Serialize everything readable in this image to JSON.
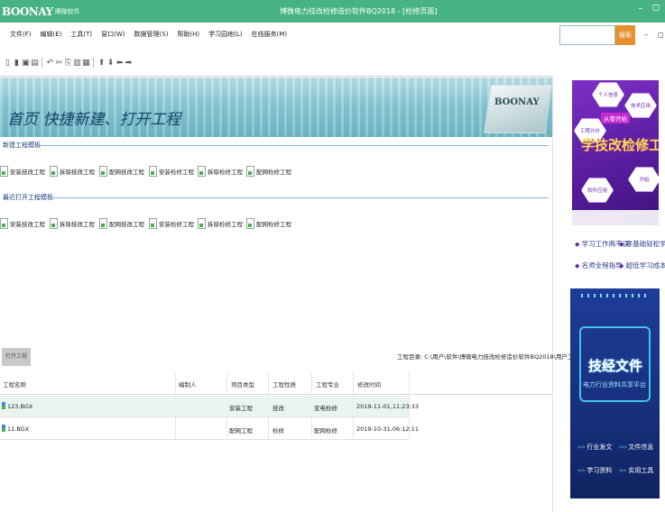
{
  "titlebar": {
    "logo_brand": "BOONAY",
    "logo_sub": "博微软件",
    "title": "博微电力技改检修造价软件BQ2018 - [检修页面]",
    "min_glyph": "–",
    "close_glyph": "◻"
  },
  "menu": [
    "文件(F)",
    "编辑(E)",
    "工具(T)",
    "窗口(W)",
    "数据管理(S)",
    "帮助(H)",
    "学习园地(L)",
    "在线服务(M)"
  ],
  "search": {
    "placeholder": "",
    "button": "搜索"
  },
  "top_controls": {
    "min": "–",
    "close": "◻"
  },
  "toolbar": {
    "icons": [
      "new-file-icon",
      "open-folder-icon",
      "save-icon",
      "save-all-icon",
      "undo-icon",
      "cut-icon",
      "copy-icon",
      "paste-icon",
      "delete-icon",
      "arrow-up-icon",
      "arrow-down-icon",
      "arrow-left-icon",
      "arrow-right-icon"
    ],
    "glyphs": [
      "▯",
      "▮",
      "▣",
      "▤",
      "↶",
      "✂",
      "⎘",
      "▥",
      "▦",
      "⬆",
      "⬇",
      "⬅",
      "➡"
    ]
  },
  "banner": {
    "text": "首页  快捷新建、打开工程",
    "card_logo": "BOONAY"
  },
  "sections": {
    "new": {
      "title": "新建工程模板",
      "items": [
        "安装技改工程",
        "拆除技改工程",
        "配网技改工程",
        "安装检修工程",
        "拆除检修工程",
        "配网检修工程"
      ]
    },
    "recent": {
      "title": "最近打开工程模板",
      "items": [
        "安装技改工程",
        "拆除技改工程",
        "配网技改工程",
        "安装检修工程",
        "拆除检修工程",
        "配网检修工程"
      ]
    }
  },
  "bottom": {
    "open_button": "打开工程",
    "dir_text": "工程目录: C:\\用户\\软件\\博微电力技改检修造价软件BQ2018\\用户工程\\2019"
  },
  "table": {
    "headers": [
      "工程名称",
      "编制人",
      "项目类型",
      "工程性质",
      "工程专业",
      "修改时间"
    ],
    "rows": [
      {
        "name": "123.BGX",
        "author": "",
        "type": "安装工程",
        "nature": "技改",
        "specialty": "变电检修",
        "time": "2019-11-01,11:23:33"
      },
      {
        "name": "11.BGX",
        "author": "",
        "type": "配网工程",
        "nature": "检修",
        "specialty": "配网检修",
        "time": "2019-10-31,06:12:11"
      }
    ]
  },
  "ad1": {
    "hex_labels": [
      "个人信息",
      "从零开始",
      "技术应用",
      "工程计价",
      "开始",
      "软件应用"
    ],
    "tag": "从零开始",
    "headline": "学技改检修工程"
  },
  "ad_links": [
    "学习工作两不误",
    "零基础轻松学",
    "名师全程指导",
    "超低学习成本"
  ],
  "ad2": {
    "title": "技经文件",
    "subtitle": "电力行业资料共享平台",
    "features": [
      "行业发文",
      "文件信息",
      "学习资料",
      "实用工具"
    ]
  }
}
